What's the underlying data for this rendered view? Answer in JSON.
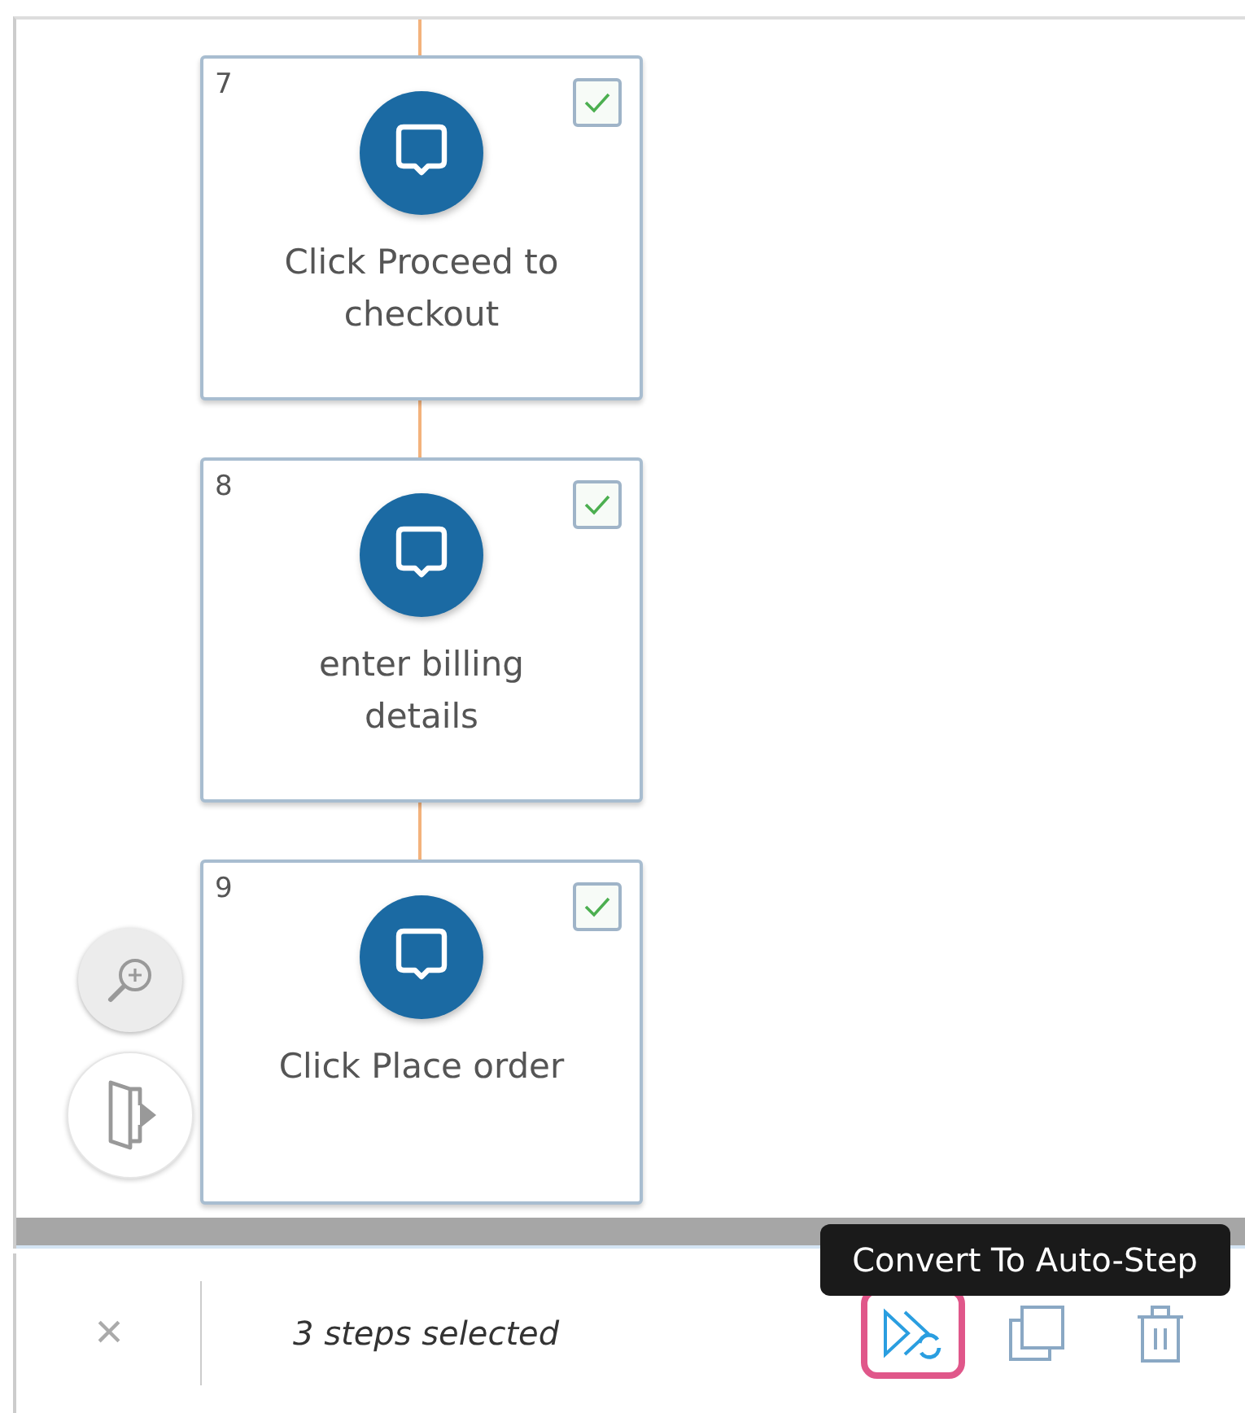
{
  "steps": [
    {
      "number": "7",
      "label": "Click Proceed to checkout",
      "checked": true
    },
    {
      "number": "8",
      "label": "enter billing details",
      "checked": true
    },
    {
      "number": "9",
      "label": "Click Place order",
      "checked": true
    }
  ],
  "selection_bar": {
    "close": "×",
    "summary": "3 steps selected",
    "actions": [
      {
        "kind": "convert",
        "highlighted": true
      },
      {
        "kind": "duplicate",
        "highlighted": false
      },
      {
        "kind": "delete",
        "highlighted": false
      }
    ],
    "tooltip": "Convert To Auto-Step"
  }
}
